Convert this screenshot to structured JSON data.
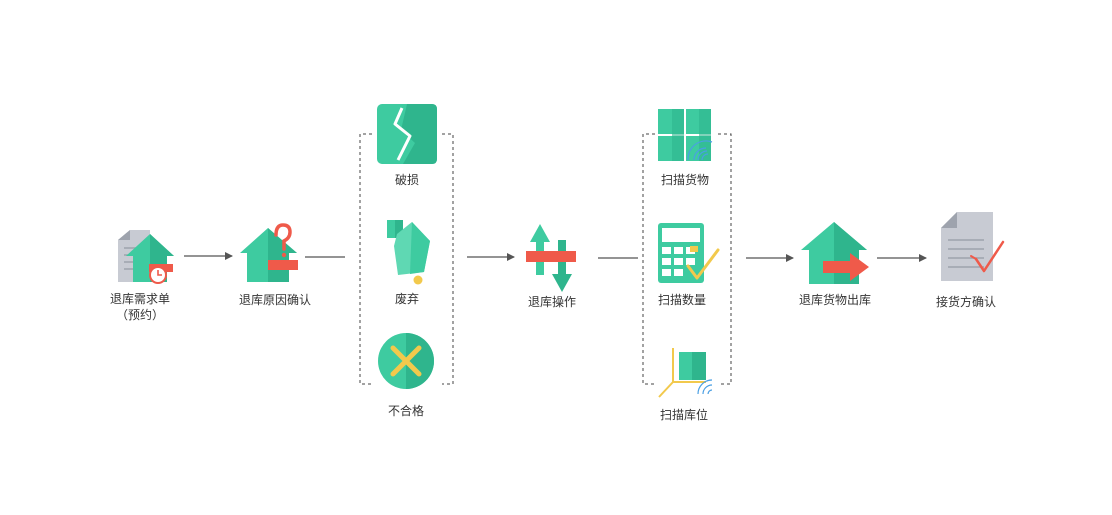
{
  "colors": {
    "green": "#3ecba0",
    "green_dark": "#2fb58d",
    "green_light": "#5fd8b3",
    "red": "#ef5a4a",
    "yellow": "#f2c94c",
    "gray": "#c8cbd3",
    "gray_dark": "#9ea3ad",
    "blue": "#4a9fe3",
    "line": "#555555"
  },
  "nodes": [
    {
      "id": "return-request",
      "label": "退库需求单",
      "label2": "（预约）",
      "icon": "house-document-clock-icon"
    },
    {
      "id": "reason-confirm",
      "label": "退库原因确认",
      "icon": "house-question-icon"
    },
    {
      "id": "damaged",
      "label": "破损",
      "icon": "broken-screen-icon"
    },
    {
      "id": "discarded",
      "label": "废弃",
      "icon": "discarded-item-icon"
    },
    {
      "id": "unqualified",
      "label": "不合格",
      "icon": "reject-x-icon"
    },
    {
      "id": "return-operation",
      "label": "退库操作",
      "icon": "transfer-arrows-icon"
    },
    {
      "id": "scan-goods",
      "label": "扫描货物",
      "icon": "scan-goods-icon"
    },
    {
      "id": "scan-quantity",
      "label": "扫描数量",
      "icon": "calculator-check-icon"
    },
    {
      "id": "scan-location",
      "label": "扫描库位",
      "icon": "scan-location-icon"
    },
    {
      "id": "goods-outbound",
      "label": "退库货物出库",
      "icon": "house-exit-arrow-icon"
    },
    {
      "id": "receiver-confirm",
      "label": "接货方确认",
      "icon": "document-check-icon"
    }
  ]
}
